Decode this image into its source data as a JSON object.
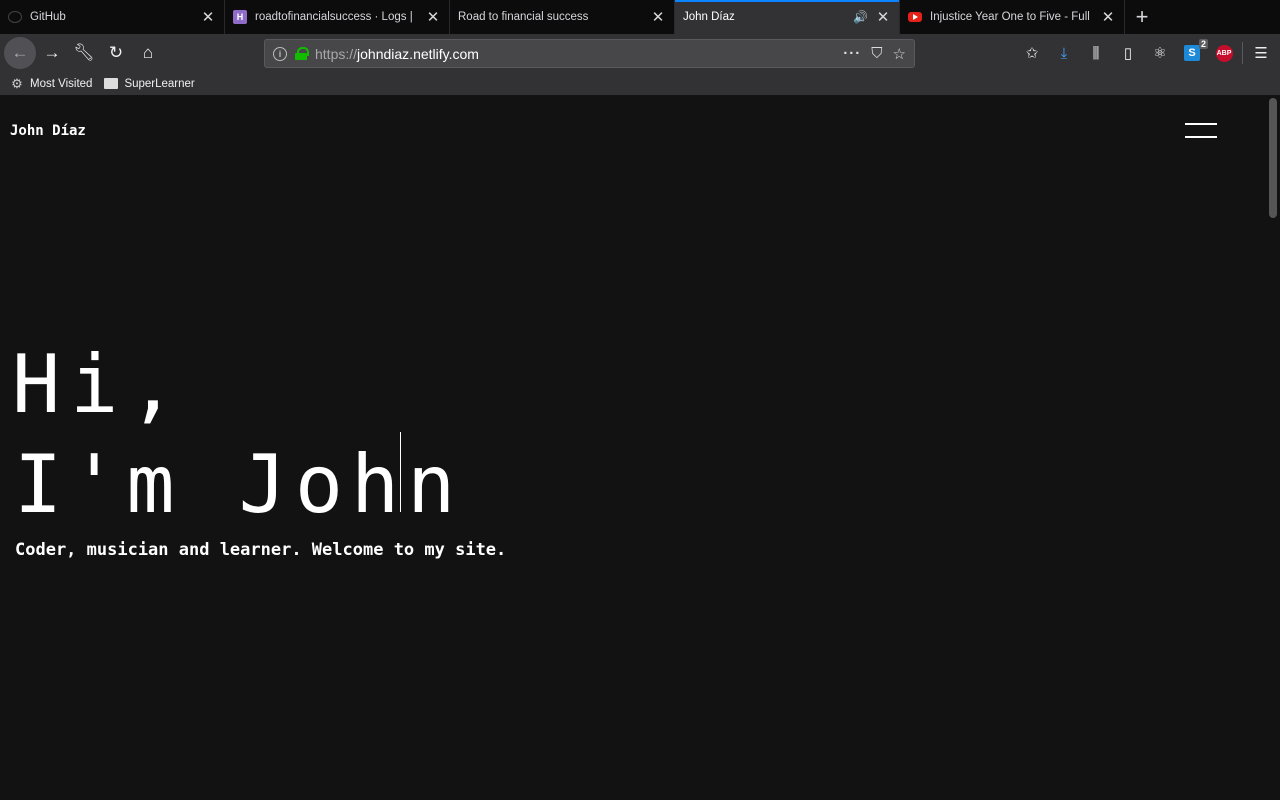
{
  "tabs": [
    {
      "title": "GitHub",
      "favicon": "github-icon"
    },
    {
      "title": "roadtofinancialsuccess · Logs |",
      "favicon": "h-logo-icon"
    },
    {
      "title": "Road to financial success",
      "favicon": ""
    },
    {
      "title": "John Díaz",
      "favicon": "",
      "active": true,
      "audio": true
    },
    {
      "title": "Injustice Year One to Five - Full",
      "favicon": "youtube-icon"
    }
  ],
  "url": {
    "protocol": "https://",
    "host": "johndiaz.netlify.com"
  },
  "bookmarks": [
    {
      "label": "Most Visited",
      "icon": "gear-icon"
    },
    {
      "label": "SuperLearner",
      "icon": "folder-icon"
    }
  ],
  "toolbar": {
    "sync_badge": "2",
    "abp_label": "ABP",
    "s_label": "S"
  },
  "site": {
    "brand": "John Díaz",
    "hero_line1": "Hi,",
    "hero_line2": "I'm John",
    "tagline": "Coder, musician and learner. Welcome to my site."
  },
  "colors": {
    "accent": "#0a84ff",
    "page_bg": "#121212",
    "lock": "#12bc00"
  }
}
